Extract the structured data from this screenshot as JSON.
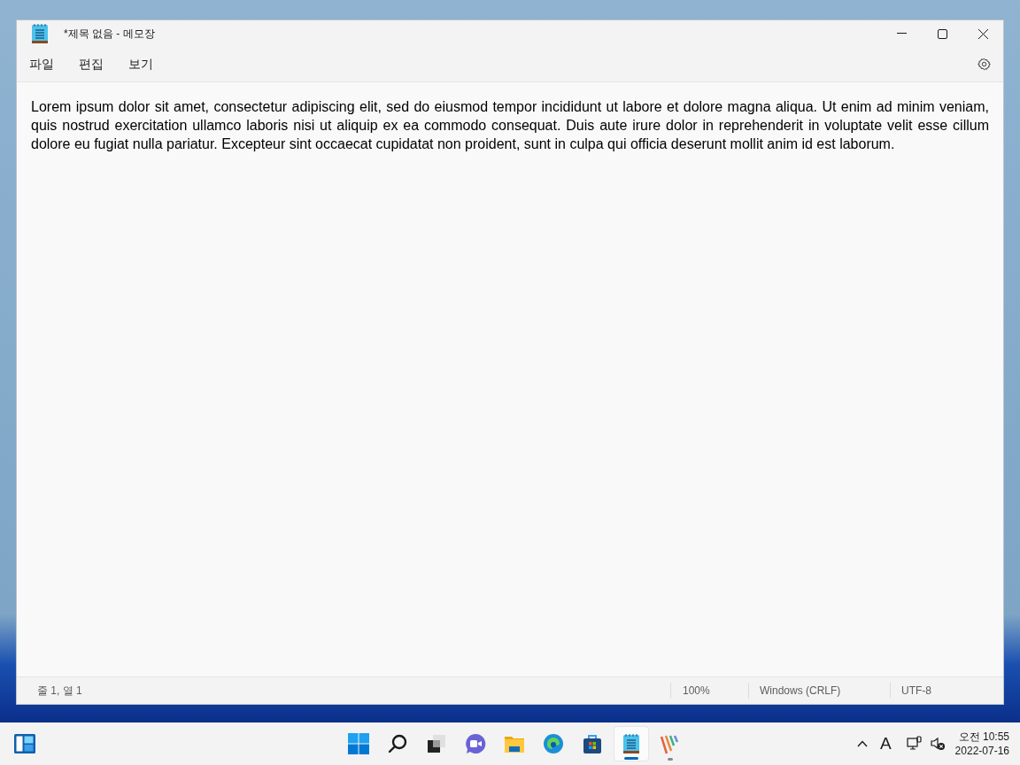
{
  "window": {
    "title": "*제목 없음 - 메모장"
  },
  "menu": [
    "파일",
    "편집",
    "보기"
  ],
  "document": {
    "text": "Lorem ipsum dolor sit amet, consectetur adipiscing elit, sed do eiusmod tempor incididunt ut labore et dolore magna aliqua. Ut enim ad minim veniam, quis nostrud exercitation ullamco laboris nisi ut aliquip ex ea commodo consequat. Duis aute irure dolor in reprehenderit in voluptate velit esse cillum dolore eu fugiat nulla pariatur. Excepteur sint occaecat cupidatat non proident, sunt in culpa qui officia deserunt mollit anim id est laborum."
  },
  "status_bar": {
    "position": "줄 1, 열 1",
    "zoom": "100%",
    "line_ending": "Windows (CRLF)",
    "encoding": "UTF-8"
  },
  "taskbar": {
    "apps": [
      {
        "kind": "start",
        "selected": false,
        "running": false
      },
      {
        "kind": "search",
        "selected": false,
        "running": false
      },
      {
        "kind": "taskview",
        "selected": false,
        "running": false
      },
      {
        "kind": "chat",
        "selected": false,
        "running": false
      },
      {
        "kind": "explorer",
        "selected": false,
        "running": false
      },
      {
        "kind": "edge",
        "selected": false,
        "running": false
      },
      {
        "kind": "store",
        "selected": false,
        "running": false
      },
      {
        "kind": "notepad",
        "selected": true,
        "running": true
      },
      {
        "kind": "stripes",
        "selected": false,
        "running": true
      }
    ],
    "ime": "A",
    "time": "오전 10:55",
    "date": "2022-07-16"
  }
}
